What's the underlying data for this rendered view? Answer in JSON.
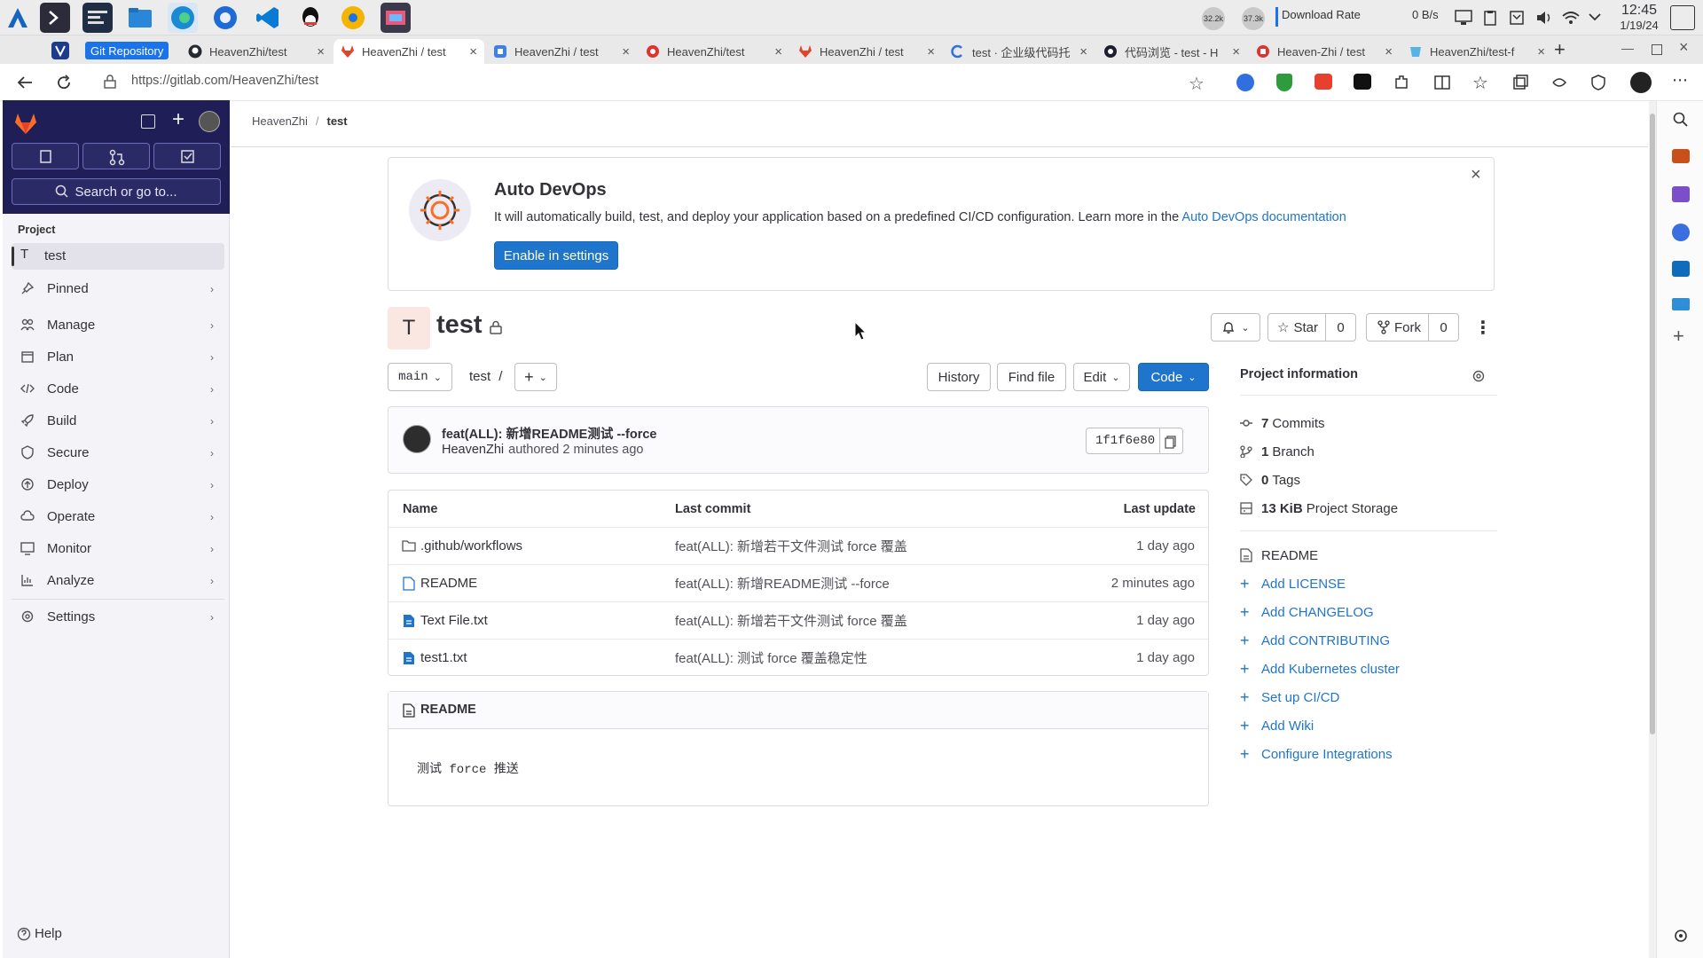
{
  "taskbar": {
    "apps": [
      "app-launcher",
      "terminal",
      "system-monitor",
      "file-manager",
      "edge-browser",
      "firefox-browser",
      "vscode",
      "qq",
      "chrome-canary",
      "screen-recorder"
    ],
    "net_up": "32.2k",
    "net_down": "37.3k",
    "download_rate_label": "Download Rate",
    "download_rate_value": "0 B/s",
    "time": "12:45",
    "date": "1/19/24"
  },
  "browser": {
    "tab_group_label": "Git Repository",
    "tabs": [
      {
        "label": "HeavenZhi/test",
        "icon": "github-icon"
      },
      {
        "label": "HeavenZhi / test",
        "icon": "gitlab-icon",
        "active": true
      },
      {
        "label": "HeavenZhi / test",
        "icon": "gitee-icon"
      },
      {
        "label": "HeavenZhi/test",
        "icon": "gitcode-icon"
      },
      {
        "label": "HeavenZhi / test",
        "icon": "gitlab-icon"
      },
      {
        "label": "test · 企业级代码托",
        "icon": "coding-icon"
      },
      {
        "label": "代码浏览 - test - H",
        "icon": "codeup-icon"
      },
      {
        "label": "Heaven-Zhi / test",
        "icon": "gitea-icon"
      },
      {
        "label": "HeavenZhi/test-f",
        "icon": "bitbucket-icon"
      }
    ],
    "url": "https://gitlab.com/HeavenZhi/test"
  },
  "sidebar": {
    "search_placeholder": "Search or go to...",
    "section_label": "Project",
    "project_initial": "T",
    "project_name": "test",
    "items": [
      {
        "label": "Pinned",
        "icon": "pin-icon"
      },
      {
        "label": "Manage",
        "icon": "users-icon"
      },
      {
        "label": "Plan",
        "icon": "planning-icon"
      },
      {
        "label": "Code",
        "icon": "code-icon"
      },
      {
        "label": "Build",
        "icon": "rocket-icon"
      },
      {
        "label": "Secure",
        "icon": "shield-icon"
      },
      {
        "label": "Deploy",
        "icon": "deployments-icon"
      },
      {
        "label": "Operate",
        "icon": "cloud-icon"
      },
      {
        "label": "Monitor",
        "icon": "monitor-icon"
      },
      {
        "label": "Analyze",
        "icon": "chart-icon"
      },
      {
        "label": "Settings",
        "icon": "gear-icon"
      }
    ],
    "help_label": "Help"
  },
  "breadcrumb": {
    "owner": "HeavenZhi",
    "separator": "/",
    "project": "test"
  },
  "devops_banner": {
    "title": "Auto DevOps",
    "text": "It will automatically build, test, and deploy your application based on a predefined CI/CD configuration. Learn more in the ",
    "link": "Auto DevOps documentation",
    "button": "Enable in settings"
  },
  "project": {
    "avatar_letter": "T",
    "name": "test",
    "star_label": "Star",
    "star_count": "0",
    "fork_label": "Fork",
    "fork_count": "0"
  },
  "repo_toolbar": {
    "branch": "main",
    "path": "test",
    "path_sep": "/",
    "history": "History",
    "find_file": "Find file",
    "edit": "Edit",
    "code": "Code"
  },
  "last_commit": {
    "message": "feat(ALL): 新增README测试 --force",
    "author": "HeavenZhi",
    "authored_text": "authored 2 minutes ago",
    "sha": "1f1f6e80"
  },
  "file_table": {
    "headers": {
      "name": "Name",
      "commit": "Last commit",
      "update": "Last update"
    },
    "rows": [
      {
        "name": ".github/workflows",
        "type": "folder",
        "commit": "feat(ALL): 新增若干文件测试 force 覆盖",
        "update": "1 day ago"
      },
      {
        "name": "README",
        "type": "readme",
        "commit": "feat(ALL): 新增README测试 --force",
        "update": "2 minutes ago"
      },
      {
        "name": "Text File.txt",
        "type": "file",
        "commit": "feat(ALL): 新增若干文件测试 force 覆盖",
        "update": "1 day ago"
      },
      {
        "name": "test1.txt",
        "type": "file",
        "commit": "feat(ALL): 测试 force 覆盖稳定性",
        "update": "1 day ago"
      }
    ]
  },
  "readme": {
    "title": "README",
    "content": "测试 force 推送"
  },
  "project_info": {
    "title": "Project information",
    "stats": [
      {
        "count": "7",
        "label": "Commits",
        "icon": "commit-icon"
      },
      {
        "count": "1",
        "label": "Branch",
        "icon": "branch-icon"
      },
      {
        "count": "0",
        "label": "Tags",
        "icon": "tag-icon"
      },
      {
        "count": "13 KiB",
        "label": "Project Storage",
        "icon": "storage-icon"
      }
    ],
    "readme_link": "README",
    "actions": [
      "Add LICENSE",
      "Add CHANGELOG",
      "Add CONTRIBUTING",
      "Add Kubernetes cluster",
      "Set up CI/CD",
      "Add Wiki",
      "Configure Integrations"
    ]
  },
  "colors": {
    "primary": "#1f75cb",
    "sidebar_top": "#1f1e56",
    "tab_group": "#1a73e8"
  }
}
